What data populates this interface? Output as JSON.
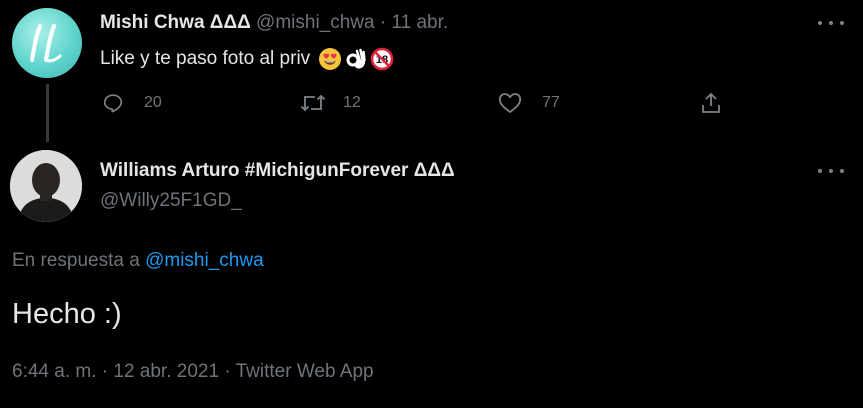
{
  "parent_tweet": {
    "author_name": "Mishi Chwa ΔΔΔ",
    "handle": "@mishi_chwa",
    "date": "11 abr.",
    "separator": " · ",
    "text": "Like y te paso foto al priv",
    "emojis": [
      "smiling-face-with-heart-eyes",
      "ok-hand",
      "no-one-under-eighteen"
    ],
    "emoji_18_text": "18",
    "reply_count": "20",
    "retweet_count": "12",
    "like_count": "77"
  },
  "reply_tweet": {
    "author_name": "Williams Arturo #MichigunForever ΔΔΔ",
    "handle": "@Willy25F1GD_",
    "reply_prefix": "En respuesta a ",
    "reply_to_handle": "@mishi_chwa",
    "text": "Hecho :)",
    "time": "6:44 a. m.",
    "date": "12 abr. 2021",
    "source": "Twitter Web App",
    "dot": " · "
  },
  "icons": {
    "reply": "reply-icon",
    "retweet": "retweet-icon",
    "like": "heart-icon",
    "share": "share-icon",
    "more": "more-icon"
  },
  "colors": {
    "background": "#000000",
    "text": "#e6e6e6",
    "muted": "#6e7479",
    "link": "#1d9bf0"
  }
}
